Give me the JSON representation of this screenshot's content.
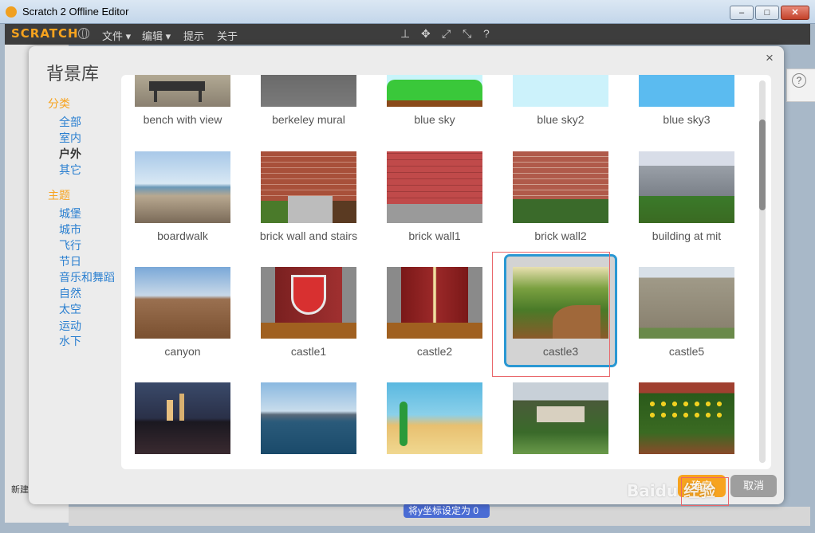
{
  "window": {
    "title": "Scratch 2 Offline Editor"
  },
  "menubar": {
    "logo": "SCRATCH",
    "items": [
      "文件 ▾",
      "编辑 ▾",
      "提示",
      "关于"
    ]
  },
  "background": {
    "new_sprite_label": "新建",
    "block_text": "将y坐标设定为",
    "block_value": "0"
  },
  "dialog": {
    "title": "背景库",
    "close": "×",
    "category_heading": "分类",
    "categories": [
      "全部",
      "室内",
      "户外",
      "其它"
    ],
    "active_category": "户外",
    "theme_heading": "主题",
    "themes": [
      "城堡",
      "城市",
      "飞行",
      "节日",
      "音乐和舞蹈",
      "自然",
      "太空",
      "运动",
      "水下"
    ],
    "items": [
      {
        "label": "bench with view"
      },
      {
        "label": "berkeley mural"
      },
      {
        "label": "blue sky"
      },
      {
        "label": "blue sky2"
      },
      {
        "label": "blue sky3"
      },
      {
        "label": "boardwalk"
      },
      {
        "label": "brick wall and stairs"
      },
      {
        "label": "brick wall1"
      },
      {
        "label": "brick wall2"
      },
      {
        "label": "building at mit"
      },
      {
        "label": "canyon"
      },
      {
        "label": "castle1"
      },
      {
        "label": "castle2"
      },
      {
        "label": "castle3"
      },
      {
        "label": "castle5"
      },
      {
        "label": ""
      },
      {
        "label": ""
      },
      {
        "label": ""
      },
      {
        "label": ""
      },
      {
        "label": ""
      }
    ],
    "selected": "castle3",
    "ok_label": "确定",
    "cancel_label": "取消"
  },
  "watermark": "Baidu 经验",
  "colors": {
    "accent": "#f7a31e",
    "link": "#2a7fd0",
    "selection": "#2a98d3"
  }
}
